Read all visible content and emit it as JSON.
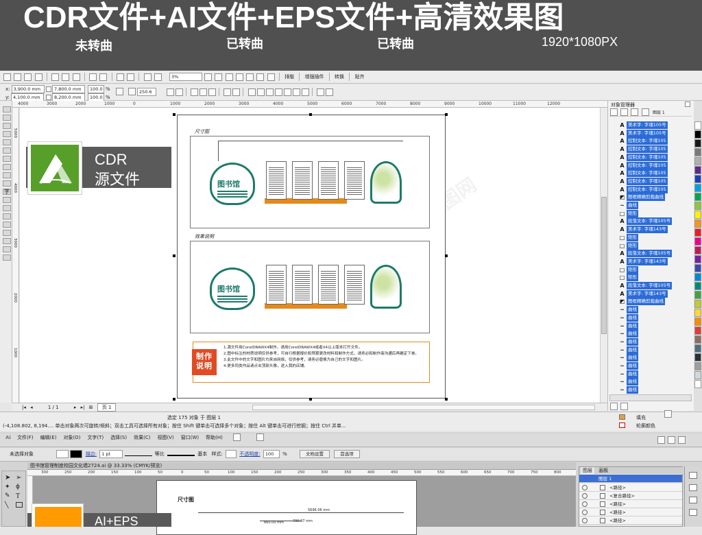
{
  "banner": {
    "title": "CDR文件+AI文件+EPS文件+高清效果图",
    "sub1": "未转曲",
    "sub2": "已转曲",
    "sub3": "已转曲",
    "resolution": "1920*1080PX"
  },
  "cdr": {
    "toolbar": {
      "zoom": "3%",
      "btn1": "排版",
      "btn2": "增强插件",
      "btn3": "转换",
      "btn4": "贴齐"
    },
    "props": {
      "x": "3,900.0 mm",
      "y": "4,100.0 mm",
      "w": "7,800.0 mm",
      "h": "8,200.0 mm",
      "sx": "100.0",
      "sy": "100.0",
      "pct": "%",
      "angle": "250.6"
    },
    "hruler": [
      "1000",
      "2000",
      "3000",
      "4000",
      "5000",
      "6000",
      "7000",
      "8000",
      "9000",
      "10000",
      "11000",
      "12000"
    ],
    "hruler_neg": [
      "4000",
      "3000",
      "2000",
      "1000",
      "0"
    ],
    "vruler": [
      "5000",
      "4000",
      "3000",
      "2000",
      "1000"
    ],
    "badge": {
      "line1": "CDR",
      "line2": "源文件"
    },
    "board1_title": "尺寸图",
    "board2_title": "效果说明",
    "sign": "图书馆",
    "notes_badge": "制作说明",
    "notes": [
      "1.源文件用CorelDRAWX4制作，请用CorelDRAWX4或者X4以上版本打开文件。",
      "2.图中标注的材质说明仅供参考，可自行根据报价和预算更改材料和制作方式，请务必和制作商沟通后再确定下单。",
      "3.此文件中的文字和图片均来自网络，仅供参考，请务必替换为自己的文字和图片。",
      "4.更多同类作品请点击顶部头像，进入我的店铺。"
    ],
    "page_nav": "1 / 1",
    "page_tab": "页 1",
    "status_main": "选定 175 对象 于 图层 1",
    "status_coords": "(-4,108.802, 8,194....  单击对象两次可旋转/倾斜；双击工具可选择所有对象；按住 Shift 键单击可选择多个对象；按住 Alt 键单击可进行挖掘；按住 Ctrl 并单...",
    "fill_label": "填充",
    "outline_label": "轮廓颜色",
    "mgr_title": "对象管理器",
    "mgr_head1": "图层 1",
    "mgr_rows": [
      {
        "icon": "A",
        "text": "美术字: 字魂105号",
        "sel": true
      },
      {
        "icon": "A",
        "text": "美术字: 字魂105号",
        "sel": true
      },
      {
        "icon": "A",
        "text": "控制文本: 字魂105",
        "sel": true
      },
      {
        "icon": "A",
        "text": "控制文本: 字魂105",
        "sel": true
      },
      {
        "icon": "A",
        "text": "控制文本: 字魂105",
        "sel": true
      },
      {
        "icon": "A",
        "text": "控制文本: 字魂105",
        "sel": true
      },
      {
        "icon": "A",
        "text": "控制文本: 字魂105",
        "sel": true
      },
      {
        "icon": "A",
        "text": "控制文本: 字魂105",
        "sel": true
      },
      {
        "icon": "A",
        "text": "控制文本: 字魂105",
        "sel": true
      },
      {
        "icon": "◩",
        "text": "图框精确剪裁曲线",
        "sel": true
      },
      {
        "icon": "~",
        "text": "曲线",
        "sel": true
      },
      {
        "icon": "□",
        "text": "矩形",
        "sel": true
      },
      {
        "icon": "A",
        "text": "段落文本: 字魂105号",
        "sel": true
      },
      {
        "icon": "A",
        "text": "美术字: 字魂143号",
        "sel": true
      },
      {
        "icon": "□",
        "text": "矩形",
        "sel": true
      },
      {
        "icon": "□",
        "text": "矩形",
        "sel": true
      },
      {
        "icon": "A",
        "text": "段落文本: 字魂105号",
        "sel": true
      },
      {
        "icon": "A",
        "text": "美术字: 字魂143号",
        "sel": true
      },
      {
        "icon": "□",
        "text": "矩形",
        "sel": true
      },
      {
        "icon": "□",
        "text": "矩形",
        "sel": true
      },
      {
        "icon": "A",
        "text": "段落文本: 字魂105号",
        "sel": true
      },
      {
        "icon": "A",
        "text": "美术字: 字魂143号",
        "sel": true
      },
      {
        "icon": "◩",
        "text": "图框精确剪裁曲线",
        "sel": true
      },
      {
        "icon": "~",
        "text": "曲线",
        "sel": true
      },
      {
        "icon": "~",
        "text": "曲线",
        "sel": true
      },
      {
        "icon": "~",
        "text": "曲线",
        "sel": true
      },
      {
        "icon": "~",
        "text": "曲线",
        "sel": true
      },
      {
        "icon": "~",
        "text": "曲线",
        "sel": true
      },
      {
        "icon": "~",
        "text": "曲线",
        "sel": true
      },
      {
        "icon": "~",
        "text": "曲线",
        "sel": true
      },
      {
        "icon": "~",
        "text": "曲线",
        "sel": true
      },
      {
        "icon": "~",
        "text": "曲线",
        "sel": true
      },
      {
        "icon": "~",
        "text": "曲线",
        "sel": true
      },
      {
        "icon": "~",
        "text": "曲线",
        "sel": true
      }
    ],
    "colors": {
      "accent_teal": "#1d7a6a",
      "accent_orange": "#e5891a",
      "badge_green": "#56a02a",
      "selection": "#2a6bd6"
    }
  },
  "ai": {
    "menu": [
      "文件(F)",
      "编辑(E)",
      "对象(O)",
      "文字(T)",
      "选择(S)",
      "效果(C)",
      "视图(V)",
      "窗口(W)",
      "帮助(H)"
    ],
    "ctrl": {
      "no_sel": "未选择对象",
      "stroke_label": "描边:",
      "stroke_val": "1 pt",
      "uniform": "等比",
      "basic": "基本",
      "style": "样式:",
      "opacity_label": "不透明度:",
      "opacity_val": "100",
      "opacity_unit": "%",
      "doc_setup": "文档设置",
      "prefs": "首选项"
    },
    "doc_tab": "图书馆管理制度校园文化墙2724.ai @ 33.33% (CMYK/预览)",
    "hruler": [
      "300",
      "250",
      "200",
      "150",
      "100",
      "50",
      "0",
      "50",
      "100",
      "150",
      "200",
      "250",
      "300",
      "350",
      "400",
      "450",
      "500",
      "550",
      "600",
      "650",
      "700",
      "750",
      "800"
    ],
    "artboard_title": "尺寸图",
    "dims": [
      "5696.06 mm",
      "660.00 mm",
      "730.97 mm"
    ],
    "badge": "AI+EPS",
    "panel_tabs": [
      "图层",
      "画板"
    ],
    "layers_head": "图层 1",
    "layers": [
      "<路径>",
      "<复合路径>",
      "<路径>",
      "<路径>",
      "<路径>"
    ]
  }
}
